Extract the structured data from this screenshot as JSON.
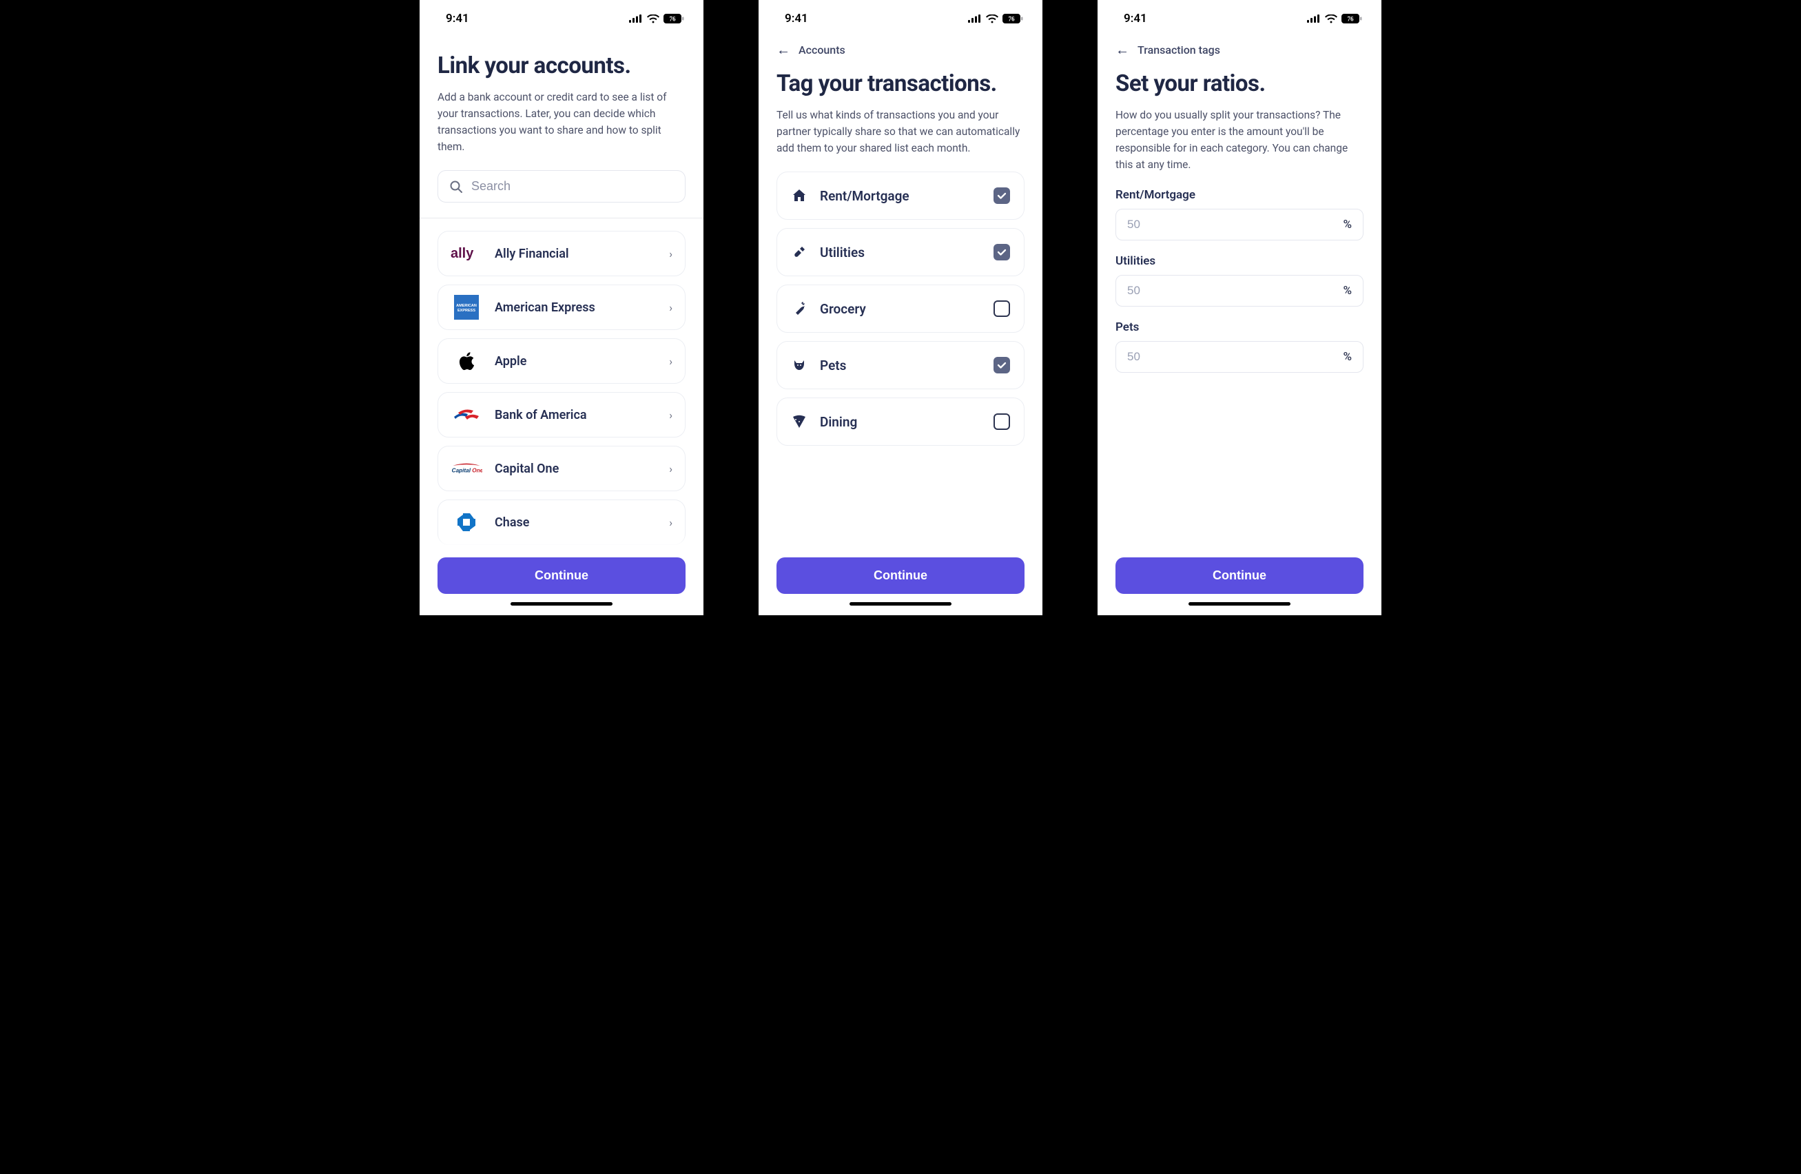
{
  "status": {
    "time": "9:41",
    "battery": "76"
  },
  "continue_label": "Continue",
  "screen1": {
    "title": "Link your accounts.",
    "subtitle": "Add a bank account or credit card to see a list of your transactions. Later, you can decide which transactions you want to share and how to split them.",
    "search_placeholder": "Search",
    "banks": [
      {
        "name": "Ally Financial"
      },
      {
        "name": "American Express"
      },
      {
        "name": "Apple"
      },
      {
        "name": "Bank of America"
      },
      {
        "name": "Capital One"
      },
      {
        "name": "Chase"
      }
    ]
  },
  "screen2": {
    "back_label": "Accounts",
    "title": "Tag your transactions.",
    "subtitle": "Tell us what kinds of transactions you and your partner typically share so that we can automatically add them to your shared list each month.",
    "tags": [
      {
        "name": "Rent/Mortgage",
        "checked": true
      },
      {
        "name": "Utilities",
        "checked": true
      },
      {
        "name": "Grocery",
        "checked": false
      },
      {
        "name": "Pets",
        "checked": true
      },
      {
        "name": "Dining",
        "checked": false
      }
    ]
  },
  "screen3": {
    "back_label": "Transaction tags",
    "title": "Set your ratios.",
    "subtitle": "How do you usually split your transactions? The percentage you enter is the amount you'll be responsible for in each category. You can change this at any time.",
    "ratios": [
      {
        "label": "Rent/Mortgage",
        "placeholder": "50"
      },
      {
        "label": "Utilities",
        "placeholder": "50"
      },
      {
        "label": "Pets",
        "placeholder": "50"
      }
    ],
    "pct_symbol": "%"
  }
}
